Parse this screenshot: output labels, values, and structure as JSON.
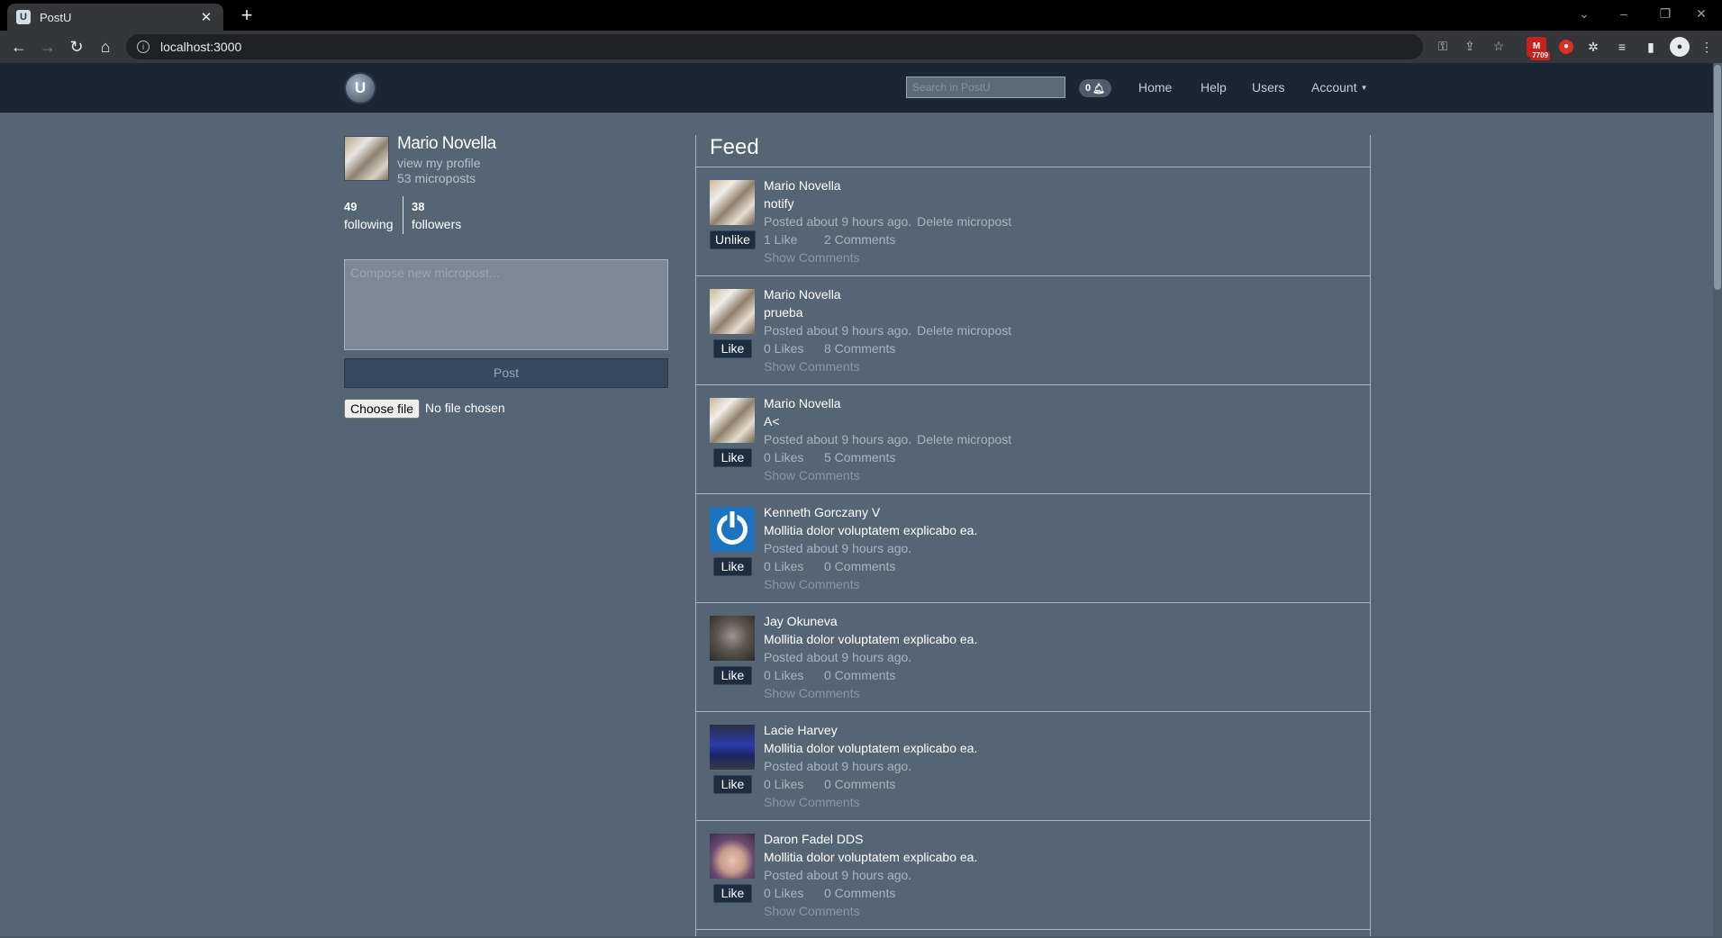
{
  "browser": {
    "tab_title": "PostU",
    "tab_favicon": "U",
    "url": "localhost:3000",
    "extension_badge": "7709"
  },
  "navbar": {
    "logo_letter": "U",
    "search_placeholder": "Search in PostU",
    "notification_count": "0",
    "links": [
      "Home",
      "Help",
      "Users",
      "Account"
    ]
  },
  "profile": {
    "name": "Mario Novella",
    "view_profile": "view my profile",
    "microposts": "53 microposts",
    "following_count": "49",
    "following_label": "following",
    "followers_count": "38",
    "followers_label": "followers"
  },
  "composer": {
    "placeholder": "Compose new micropost...",
    "post_label": "Post",
    "file_button": "Choose file",
    "file_status": "No file chosen"
  },
  "feed": {
    "title": "Feed",
    "items": [
      {
        "author": "Mario Novella",
        "content": "notify",
        "posted": "Posted about 9 hours ago.",
        "delete": "Delete micropost",
        "action": "Unlike",
        "likes": "1 Like",
        "comments": "2 Comments",
        "show": "Show Comments"
      },
      {
        "author": "Mario Novella",
        "content": "prueba",
        "posted": "Posted about 9 hours ago.",
        "delete": "Delete micropost",
        "action": "Like",
        "likes": "0 Likes",
        "comments": "8 Comments",
        "show": "Show Comments"
      },
      {
        "author": "Mario Novella",
        "content": "A<",
        "posted": "Posted about 9 hours ago.",
        "delete": "Delete micropost",
        "action": "Like",
        "likes": "0 Likes",
        "comments": "5 Comments",
        "show": "Show Comments"
      },
      {
        "author": "Kenneth Gorczany V",
        "content": "Mollitia dolor voluptatem explicabo ea.",
        "posted": "Posted about 9 hours ago.",
        "action": "Like",
        "likes": "0 Likes",
        "comments": "0 Comments",
        "show": "Show Comments"
      },
      {
        "author": "Jay Okuneva",
        "content": "Mollitia dolor voluptatem explicabo ea.",
        "posted": "Posted about 9 hours ago.",
        "action": "Like",
        "likes": "0 Likes",
        "comments": "0 Comments",
        "show": "Show Comments"
      },
      {
        "author": "Lacie Harvey",
        "content": "Mollitia dolor voluptatem explicabo ea.",
        "posted": "Posted about 9 hours ago.",
        "action": "Like",
        "likes": "0 Likes",
        "comments": "0 Comments",
        "show": "Show Comments"
      },
      {
        "author": "Daron Fadel DDS",
        "content": "Mollitia dolor voluptatem explicabo ea.",
        "posted": "Posted about 9 hours ago.",
        "action": "Like",
        "likes": "0 Likes",
        "comments": "0 Comments",
        "show": "Show Comments"
      }
    ]
  },
  "colors": {
    "page_background": "#566573",
    "navbar_background": "#1a2634",
    "button_dark": "#1d2c3e"
  }
}
